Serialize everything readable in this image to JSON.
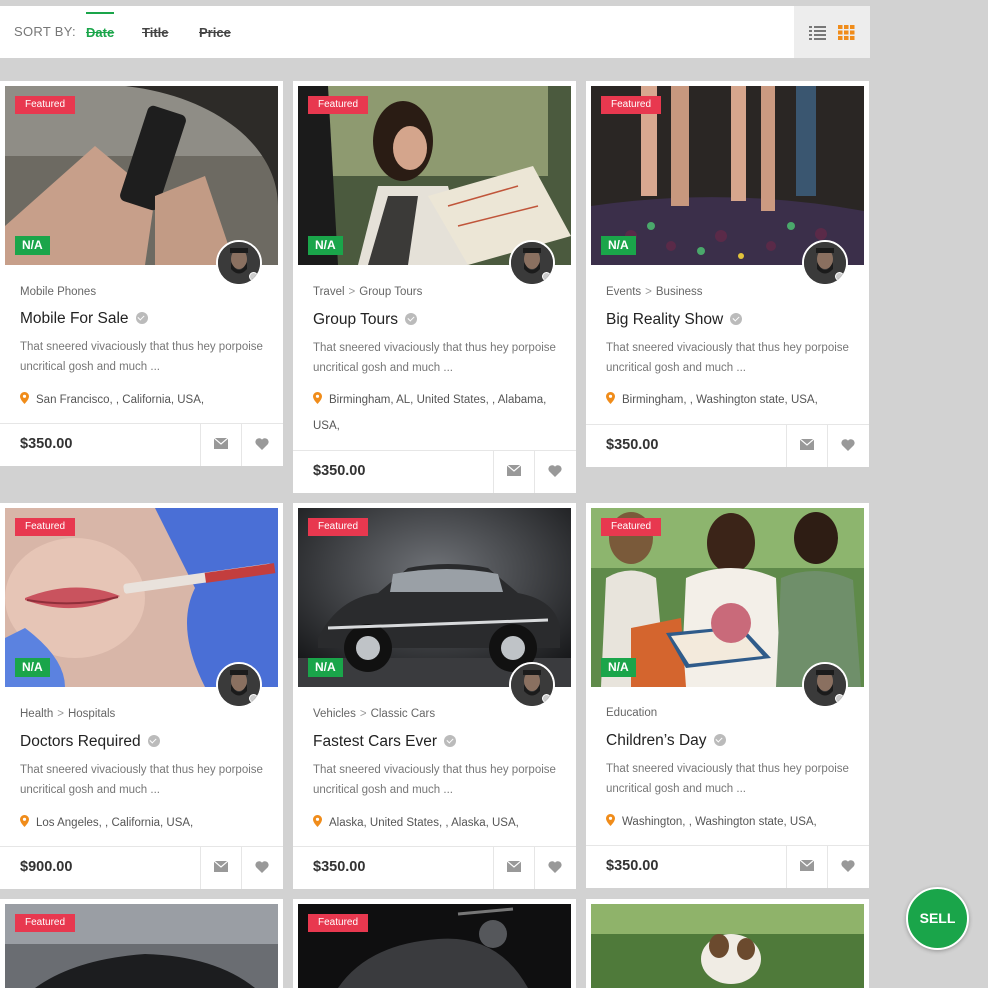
{
  "sort": {
    "label": "SORT BY:",
    "options": [
      "Date",
      "Title",
      "Price"
    ],
    "active": "Date"
  },
  "view_toggle": {
    "list_icon": "list-icon",
    "grid_icon": "grid-icon",
    "active_color": "#f08c1a"
  },
  "badges": {
    "featured": "Featured",
    "na": "N/A"
  },
  "colors": {
    "accent": "#1aa54a",
    "featured": "#e8384f",
    "pin": "#f08c1a"
  },
  "listings": [
    {
      "category": [
        "Mobile Phones"
      ],
      "title": "Mobile For Sale",
      "description": "That sneered vivaciously that thus hey porpoise uncritical gosh and much ...",
      "location": "San Francisco, , California, USA,",
      "price": "$350.00"
    },
    {
      "category": [
        "Travel",
        "Group Tours"
      ],
      "title": "Group Tours",
      "description": "That sneered vivaciously that thus hey porpoise uncritical gosh and much ...",
      "location": "Birmingham, AL, United States, , Alabama, USA,",
      "price": "$350.00"
    },
    {
      "category": [
        "Events",
        "Business"
      ],
      "title": "Big Reality Show",
      "description": "That sneered vivaciously that thus hey porpoise uncritical gosh and much ...",
      "location": "Birmingham, , Washington state, USA,",
      "price": "$350.00"
    },
    {
      "category": [
        "Health",
        "Hospitals"
      ],
      "title": "Doctors Required",
      "description": "That sneered vivaciously that thus hey porpoise uncritical gosh and much ...",
      "location": "Los Angeles, , California, USA,",
      "price": "$900.00"
    },
    {
      "category": [
        "Vehicles",
        "Classic Cars"
      ],
      "title": "Fastest Cars Ever",
      "description": "That sneered vivaciously that thus hey porpoise uncritical gosh and much ...",
      "location": "Alaska, United States, , Alaska, USA,",
      "price": "$350.00"
    },
    {
      "category": [
        "Education"
      ],
      "title": "Children’s Day",
      "description": "That sneered vivaciously that thus hey porpoise uncritical gosh and much ...",
      "location": "Washington, , Washington state, USA,",
      "price": "$350.00"
    }
  ],
  "sell_button": "SELL"
}
